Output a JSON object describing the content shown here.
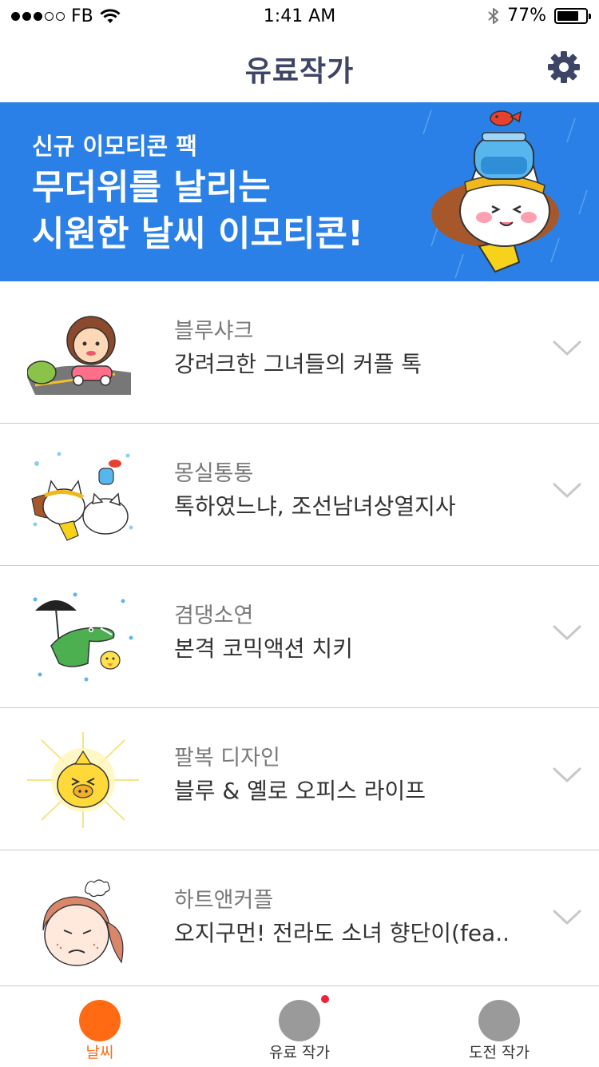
{
  "status_bar": {
    "carrier": "FB",
    "time": "1:41 AM",
    "battery": "77%",
    "battery_level": 0.77,
    "signal_bars_filled": 3,
    "signal_bars_total": 5
  },
  "header": {
    "title": "유료작가",
    "settings_icon": "gear-icon",
    "title_color": "#3d4466"
  },
  "banner": {
    "subtitle": "신규 이모티콘 팩",
    "headline_line1": "무더위를 날리는",
    "headline_line2": "시원한 날씨 이모티콘!",
    "background": "#2a80e6"
  },
  "packs": [
    {
      "author": "블루샤크",
      "title": "강려크한 그녀들의 커플 톡"
    },
    {
      "author": "몽실통통",
      "title": "톡하였느냐, 조선남녀상열지사"
    },
    {
      "author": "겸댕소연",
      "title": "본격 코믹액션 치키"
    },
    {
      "author": "팔복 디자인",
      "title": "블루 & 옐로 오피스 라이프"
    },
    {
      "author": "하트앤커플",
      "title": "오지구먼! 전라도 소녀 향단이(fea.."
    }
  ],
  "tabs": [
    {
      "label": "날씨",
      "active": true,
      "badge": false
    },
    {
      "label": "유료 작가",
      "active": false,
      "badge": true
    },
    {
      "label": "도전 작가",
      "active": false,
      "badge": false
    }
  ],
  "colors": {
    "accent": "#ff6a13",
    "inactive_tab": "#9a9a9a",
    "badge": "#ef2335"
  }
}
